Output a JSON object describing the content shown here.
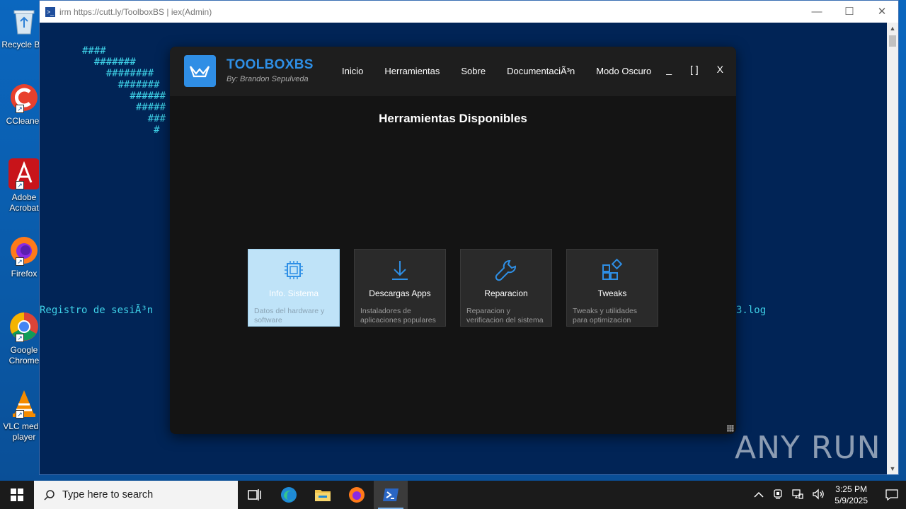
{
  "desktop": {
    "icons": [
      {
        "label": "Recycle Bin",
        "icon": "recycle-bin-icon"
      },
      {
        "label": "CCleaner",
        "icon": "ccleaner-icon"
      },
      {
        "label": "Adobe Acrobat",
        "icon": "acrobat-icon"
      },
      {
        "label": "Firefox",
        "icon": "firefox-icon"
      },
      {
        "label": "Google Chrome",
        "icon": "chrome-icon"
      },
      {
        "label": "VLC media player",
        "icon": "vlc-icon"
      }
    ]
  },
  "powershell": {
    "title": "irm https://cutt.ly/ToolboxBS | iex(Admin)",
    "art_lines": [
      "####",
      "  #######",
      "    ########",
      "      #######",
      "        ######",
      "         #####",
      "           ###",
      "            #"
    ],
    "log_left": "Registro de sesiÃ³n",
    "log_right": "3.log"
  },
  "app": {
    "brand": "TOOLBOXBS",
    "byline": "By: Brandon Sepulveda",
    "nav": [
      "Inicio",
      "Herramientas",
      "Sobre",
      "DocumentaciÃ³n",
      "Modo Oscuro"
    ],
    "controls": {
      "minimize": "_",
      "maximize": "[ ]",
      "close": "X"
    },
    "section_title": "Herramientas Disponibles",
    "tools": [
      {
        "title": "Info. Sistema",
        "desc": "Datos del hardware y software",
        "icon": "cpu-chip-icon",
        "selected": true
      },
      {
        "title": "Descargas Apps",
        "desc": "Instaladores de aplicaciones populares",
        "icon": "download-icon",
        "selected": false
      },
      {
        "title": "Reparacion",
        "desc": "Reparacion y verificacion del sistema",
        "icon": "wrench-icon",
        "selected": false
      },
      {
        "title": "Tweaks",
        "desc": "Tweaks y utilidades para optimizacion",
        "icon": "tweaks-grid-icon",
        "selected": false
      }
    ],
    "accent": "#2e8fe6"
  },
  "watermark": "ANY RUN",
  "taskbar": {
    "search_placeholder": "Type here to search",
    "time": "3:25 PM",
    "date": "5/9/2025"
  }
}
